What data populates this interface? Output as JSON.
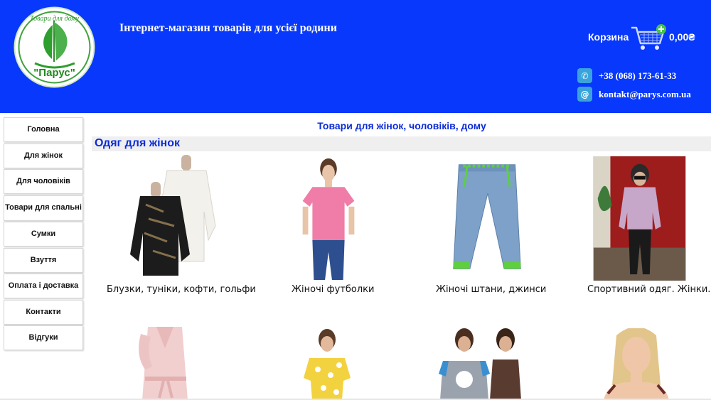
{
  "header": {
    "logo_text": "\"Парус\"",
    "logo_arc_text": "Товари для дому",
    "tagline": "Інтернет-магазин товарів для усієї родини",
    "cart_label": "Корзина",
    "cart_total": "0,00₴",
    "phone": "+38 (068) 173-61-33",
    "email": "kontakt@parys.com.ua"
  },
  "sidebar": {
    "items": [
      {
        "label": "Головна"
      },
      {
        "label": "Для жінок"
      },
      {
        "label": "Для чоловіків"
      },
      {
        "label": "Товари для спальні"
      },
      {
        "label": "Сумки"
      },
      {
        "label": "Взуття"
      },
      {
        "label": "Оплата і доставка"
      },
      {
        "label": "Контакти"
      },
      {
        "label": "Відгуки"
      }
    ]
  },
  "main": {
    "page_heading": "Товари для жінок, чоловіків, дому",
    "section_title": "Одяг для жінок",
    "products": [
      {
        "name": "Блузки, туніки, кофти, гольфи"
      },
      {
        "name": "Жіночі футболки"
      },
      {
        "name": "Жіночі штани, джинси"
      },
      {
        "name": "Спортивний одяг. Жінки."
      },
      {
        "name": ""
      },
      {
        "name": ""
      },
      {
        "name": ""
      },
      {
        "name": ""
      }
    ]
  },
  "colors": {
    "header_bg": "#0738fb",
    "heading_blue": "#0b2bd6",
    "logo_green": "#2e9e2e"
  }
}
